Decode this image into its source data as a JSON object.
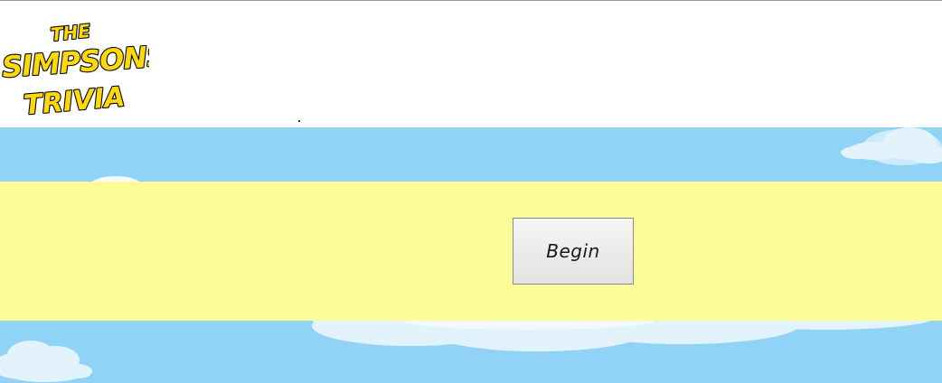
{
  "app": {
    "logo_text": "THE SIMPSONS TRIVIA"
  },
  "main": {
    "begin_label": "Begin"
  },
  "colors": {
    "sky": "#90d3f6",
    "band": "#fcfc98",
    "cloud": "#dff1fb",
    "logo_fill": "#fdd90c",
    "logo_outline": "#000000"
  }
}
